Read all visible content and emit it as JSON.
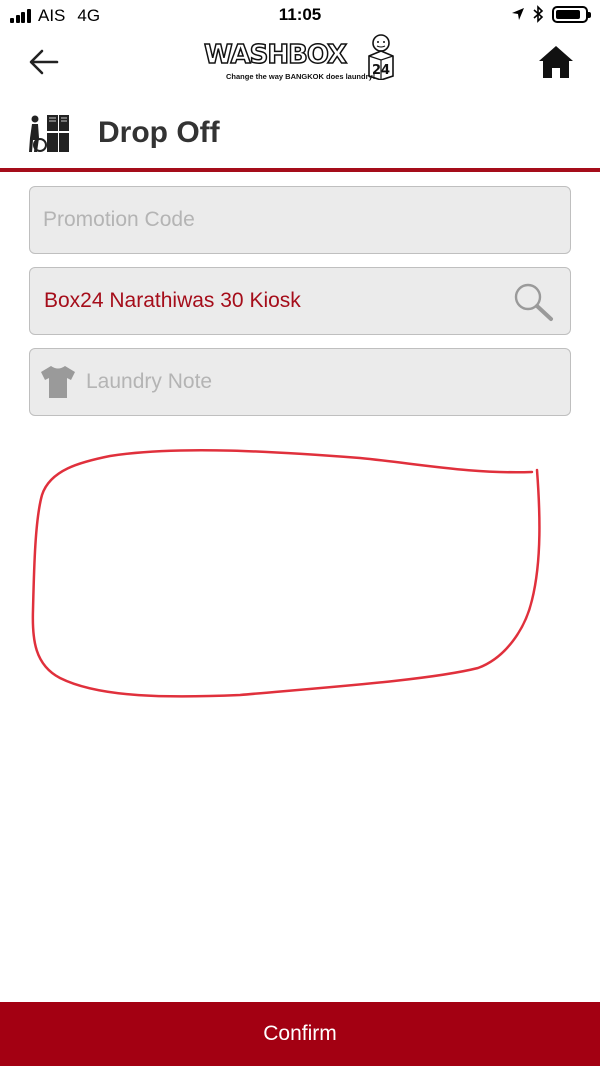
{
  "status_bar": {
    "carrier": "AIS",
    "network": "4G",
    "time": "11:05",
    "signal_bars": 4,
    "battery_level": 0.85
  },
  "header": {
    "logo_text": "WASHBOX",
    "logo_badge": "24",
    "logo_tagline": "Change the way BANGKOK does laundry!",
    "back_icon": "arrow-left-icon",
    "home_icon": "home-icon"
  },
  "page": {
    "title": "Drop Off",
    "title_icon": "locker-person-icon",
    "accent_color": "#a50d1a"
  },
  "form": {
    "promotion_code": {
      "placeholder": "Promotion Code",
      "value": ""
    },
    "location": {
      "value": "Box24 Narathiwas 30 Kiosk",
      "icon": "search-icon"
    },
    "laundry_note": {
      "placeholder": "Laundry Note",
      "value": "",
      "icon": "shirt-icon"
    }
  },
  "annotation": {
    "color": "#e0303c",
    "shape": "hand-drawn-loop"
  },
  "footer": {
    "confirm_label": "Confirm",
    "color": "#a30012"
  }
}
